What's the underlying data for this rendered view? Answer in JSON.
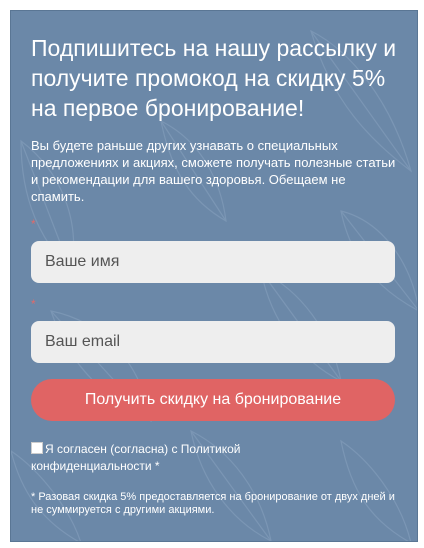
{
  "form": {
    "title": "Подпишитесь на нашу рассылку и получите промокод на скидку 5% на первое бронирование!",
    "description": "Вы будете раньше других узнавать о специальных предложениях и акциях, сможете получать полезные статьи и рекомендации для вашего здоровья. Обещаем не спамить.",
    "required_mark": "*",
    "name_placeholder": "Ваше имя",
    "email_placeholder": "Ваш email",
    "submit_label": "Получить скидку на бронирование",
    "consent_label": "Я согласен (согласна) с Политикой конфиденциальности *",
    "footnote": "* Разовая скидка 5% предоставляется на бронирование от двух дней и не суммируется с другими акциями."
  },
  "colors": {
    "background": "#6b88a8",
    "button": "#e06464",
    "field": "#eeeeee",
    "text": "#ffffff"
  },
  "decorative_icons": [
    "leaf-pattern"
  ]
}
